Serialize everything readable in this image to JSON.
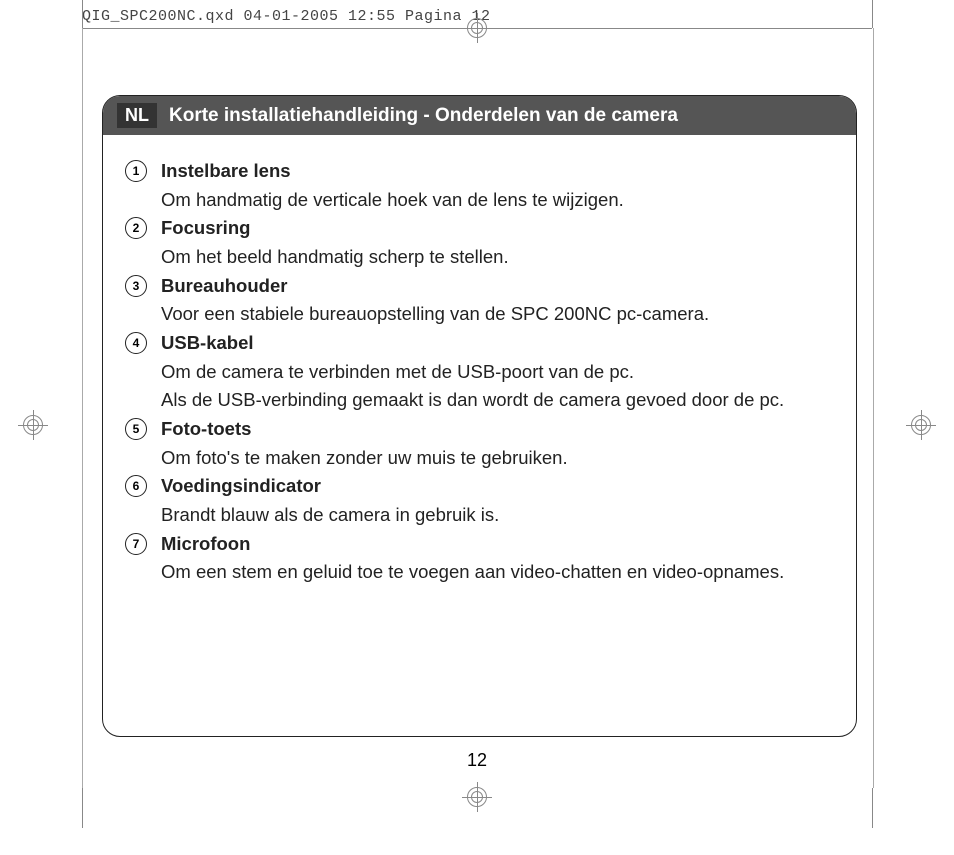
{
  "meta_header": "QIG_SPC200NC.qxd  04-01-2005  12:55  Pagina 12",
  "lang_badge": "NL",
  "title": "Korte installatiehandleiding - Onderdelen van de camera",
  "items": [
    {
      "num": "1",
      "title": "Instelbare lens",
      "desc": "Om handmatig de verticale hoek van de lens te wijzigen."
    },
    {
      "num": "2",
      "title": "Focusring",
      "desc": "Om het beeld handmatig scherp te stellen."
    },
    {
      "num": "3",
      "title": "Bureauhouder",
      "desc": "Voor een stabiele bureauopstelling van de SPC 200NC pc-camera."
    },
    {
      "num": "4",
      "title": "USB-kabel",
      "desc": "Om de camera te verbinden met de USB-poort van de pc.\nAls de USB-verbinding gemaakt is dan wordt de camera gevoed door de pc."
    },
    {
      "num": "5",
      "title": "Foto-toets",
      "desc": "Om foto's te maken zonder uw muis te gebruiken."
    },
    {
      "num": "6",
      "title": "Voedingsindicator",
      "desc": "Brandt blauw als de camera in gebruik is."
    },
    {
      "num": "7",
      "title": "Microfoon",
      "desc": "Om een stem en geluid toe te voegen aan video-chatten en video-opnames."
    }
  ],
  "page_number": "12"
}
